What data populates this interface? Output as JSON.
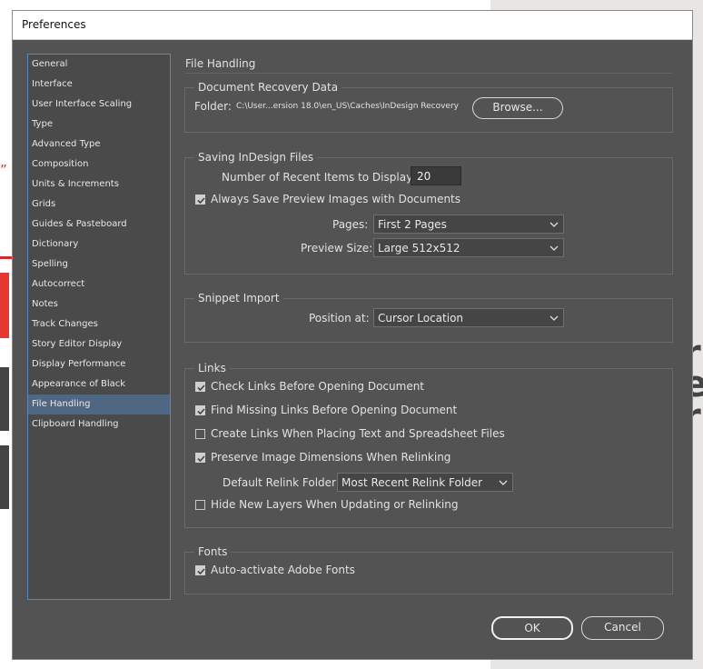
{
  "window": {
    "title": "Preferences"
  },
  "background": {
    "left_text": "” f"
  },
  "sidebar": {
    "items": [
      {
        "label": "General"
      },
      {
        "label": "Interface"
      },
      {
        "label": "User Interface Scaling"
      },
      {
        "label": "Type"
      },
      {
        "label": "Advanced Type"
      },
      {
        "label": "Composition"
      },
      {
        "label": "Units & Increments"
      },
      {
        "label": "Grids"
      },
      {
        "label": "Guides & Pasteboard"
      },
      {
        "label": "Dictionary"
      },
      {
        "label": "Spelling"
      },
      {
        "label": "Autocorrect"
      },
      {
        "label": "Notes"
      },
      {
        "label": "Track Changes"
      },
      {
        "label": "Story Editor Display"
      },
      {
        "label": "Display Performance"
      },
      {
        "label": "Appearance of Black"
      },
      {
        "label": "File Handling",
        "selected": true
      },
      {
        "label": "Clipboard Handling"
      }
    ]
  },
  "main": {
    "title": "File Handling",
    "recovery": {
      "legend": "Document Recovery Data",
      "folder_label": "Folder:",
      "folder_path": "C:\\User...ersion 18.0\\en_US\\Caches\\InDesign Recovery",
      "browse_label": "Browse..."
    },
    "saving": {
      "legend": "Saving InDesign Files",
      "recent_label": "Number of Recent Items to Display:",
      "recent_value": "20",
      "preview_label": "Always Save Preview Images with Documents",
      "preview_checked": true,
      "pages_label": "Pages:",
      "pages_value": "First 2 Pages",
      "size_label": "Preview Size:",
      "size_value": "Large 512x512"
    },
    "snippet": {
      "legend": "Snippet Import",
      "position_label": "Position at:",
      "position_value": "Cursor Location"
    },
    "links": {
      "legend": "Links",
      "check_label": "Check Links Before Opening Document",
      "check_checked": true,
      "find_label": "Find Missing Links Before Opening Document",
      "find_checked": true,
      "create_label": "Create Links When Placing Text and Spreadsheet Files",
      "create_checked": false,
      "preserve_label": "Preserve Image Dimensions When Relinking",
      "preserve_checked": true,
      "relink_label": "Default Relink Folder:",
      "relink_value": "Most Recent Relink Folder",
      "hide_label": "Hide New Layers When Updating or Relinking",
      "hide_checked": false
    },
    "fonts": {
      "legend": "Fonts",
      "auto_label": "Auto-activate Adobe Fonts",
      "auto_checked": true
    }
  },
  "footer": {
    "ok_label": "OK",
    "cancel_label": "Cancel"
  },
  "colors": {
    "selected_item": "#4f6783",
    "panel": "#535353",
    "sidebar_border": "#5b86b9"
  }
}
